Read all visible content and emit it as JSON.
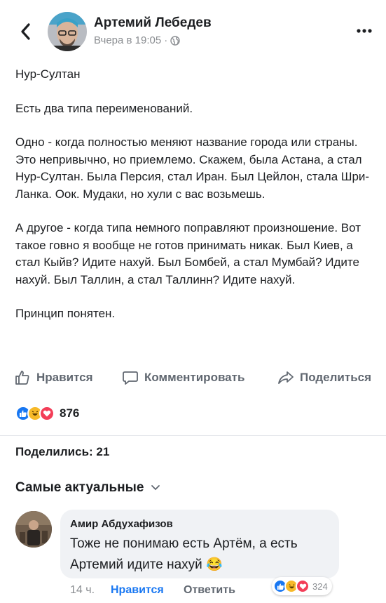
{
  "header": {
    "author": "Артемий Лебедев",
    "time": "Вчера в 19:05",
    "separator": "·",
    "back_icon": "chevron-left-icon",
    "privacy_icon": "globe-icon",
    "more_icon": "more-dots-icon"
  },
  "post": {
    "paragraphs": [
      "Нур-Султан",
      "Есть два типа переименований.",
      "Одно - когда полностью меняют название города или страны. Это непривычно, но приемлемо. Скажем, была Астана, а стал Нур-Султан. Была Персия, стал Иран. Был Цейлон, стала Шри-Ланка. Оок. Мудаки, но хули с вас возьмешь.",
      "А другое - когда типа немного поправляют произношение. Вот такое говно я вообще не готов принимать никак. Был Киев, а стал Кыйв? Идите нахуй. Был Бомбей, а стал Мумбай? Идите нахуй. Был Таллин, а стал Таллинн? Идите нахуй.",
      "Принцип понятен."
    ]
  },
  "actions": {
    "like": "Нравится",
    "comment": "Комментировать",
    "share": "Поделиться"
  },
  "reactions": {
    "count": "876",
    "icons": [
      "like-reaction-icon",
      "haha-reaction-icon",
      "love-reaction-icon"
    ]
  },
  "shares": "Поделились: 21",
  "comments_sort": {
    "label": "Самые актуальные",
    "icon": "chevron-down-icon"
  },
  "comment": {
    "name": "Амир Абдухафизов",
    "text": "Тоже не понимаю есть Артём, а есть Артемий идите нахуй 😂",
    "time": "14 ч.",
    "like": "Нравится",
    "reply": "Ответить",
    "reaction_count": "324"
  },
  "colors": {
    "accent": "#1877f2",
    "secondary_text": "#606770",
    "muted_text": "#8a8d91",
    "bubble_bg": "#f0f2f5",
    "love": "#f33e58",
    "haha": "#f7b928"
  }
}
